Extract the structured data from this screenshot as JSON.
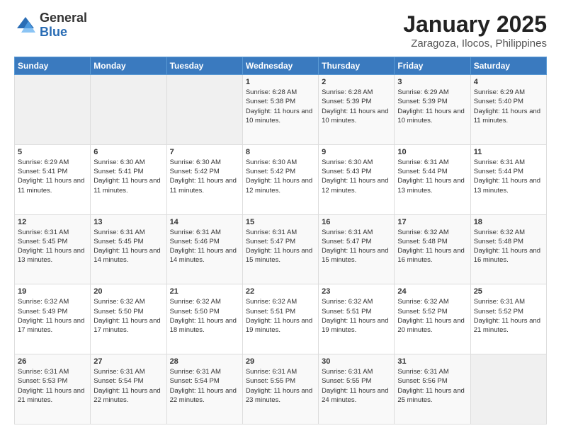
{
  "logo": {
    "general": "General",
    "blue": "Blue"
  },
  "title": "January 2025",
  "subtitle": "Zaragoza, Ilocos, Philippines",
  "days_of_week": [
    "Sunday",
    "Monday",
    "Tuesday",
    "Wednesday",
    "Thursday",
    "Friday",
    "Saturday"
  ],
  "weeks": [
    [
      {
        "day": "",
        "sunrise": "",
        "sunset": "",
        "daylight": "",
        "empty": true
      },
      {
        "day": "",
        "sunrise": "",
        "sunset": "",
        "daylight": "",
        "empty": true
      },
      {
        "day": "",
        "sunrise": "",
        "sunset": "",
        "daylight": "",
        "empty": true
      },
      {
        "day": "1",
        "sunrise": "Sunrise: 6:28 AM",
        "sunset": "Sunset: 5:38 PM",
        "daylight": "Daylight: 11 hours and 10 minutes.",
        "empty": false
      },
      {
        "day": "2",
        "sunrise": "Sunrise: 6:28 AM",
        "sunset": "Sunset: 5:39 PM",
        "daylight": "Daylight: 11 hours and 10 minutes.",
        "empty": false
      },
      {
        "day": "3",
        "sunrise": "Sunrise: 6:29 AM",
        "sunset": "Sunset: 5:39 PM",
        "daylight": "Daylight: 11 hours and 10 minutes.",
        "empty": false
      },
      {
        "day": "4",
        "sunrise": "Sunrise: 6:29 AM",
        "sunset": "Sunset: 5:40 PM",
        "daylight": "Daylight: 11 hours and 11 minutes.",
        "empty": false
      }
    ],
    [
      {
        "day": "5",
        "sunrise": "Sunrise: 6:29 AM",
        "sunset": "Sunset: 5:41 PM",
        "daylight": "Daylight: 11 hours and 11 minutes.",
        "empty": false
      },
      {
        "day": "6",
        "sunrise": "Sunrise: 6:30 AM",
        "sunset": "Sunset: 5:41 PM",
        "daylight": "Daylight: 11 hours and 11 minutes.",
        "empty": false
      },
      {
        "day": "7",
        "sunrise": "Sunrise: 6:30 AM",
        "sunset": "Sunset: 5:42 PM",
        "daylight": "Daylight: 11 hours and 11 minutes.",
        "empty": false
      },
      {
        "day": "8",
        "sunrise": "Sunrise: 6:30 AM",
        "sunset": "Sunset: 5:42 PM",
        "daylight": "Daylight: 11 hours and 12 minutes.",
        "empty": false
      },
      {
        "day": "9",
        "sunrise": "Sunrise: 6:30 AM",
        "sunset": "Sunset: 5:43 PM",
        "daylight": "Daylight: 11 hours and 12 minutes.",
        "empty": false
      },
      {
        "day": "10",
        "sunrise": "Sunrise: 6:31 AM",
        "sunset": "Sunset: 5:44 PM",
        "daylight": "Daylight: 11 hours and 13 minutes.",
        "empty": false
      },
      {
        "day": "11",
        "sunrise": "Sunrise: 6:31 AM",
        "sunset": "Sunset: 5:44 PM",
        "daylight": "Daylight: 11 hours and 13 minutes.",
        "empty": false
      }
    ],
    [
      {
        "day": "12",
        "sunrise": "Sunrise: 6:31 AM",
        "sunset": "Sunset: 5:45 PM",
        "daylight": "Daylight: 11 hours and 13 minutes.",
        "empty": false
      },
      {
        "day": "13",
        "sunrise": "Sunrise: 6:31 AM",
        "sunset": "Sunset: 5:45 PM",
        "daylight": "Daylight: 11 hours and 14 minutes.",
        "empty": false
      },
      {
        "day": "14",
        "sunrise": "Sunrise: 6:31 AM",
        "sunset": "Sunset: 5:46 PM",
        "daylight": "Daylight: 11 hours and 14 minutes.",
        "empty": false
      },
      {
        "day": "15",
        "sunrise": "Sunrise: 6:31 AM",
        "sunset": "Sunset: 5:47 PM",
        "daylight": "Daylight: 11 hours and 15 minutes.",
        "empty": false
      },
      {
        "day": "16",
        "sunrise": "Sunrise: 6:31 AM",
        "sunset": "Sunset: 5:47 PM",
        "daylight": "Daylight: 11 hours and 15 minutes.",
        "empty": false
      },
      {
        "day": "17",
        "sunrise": "Sunrise: 6:32 AM",
        "sunset": "Sunset: 5:48 PM",
        "daylight": "Daylight: 11 hours and 16 minutes.",
        "empty": false
      },
      {
        "day": "18",
        "sunrise": "Sunrise: 6:32 AM",
        "sunset": "Sunset: 5:48 PM",
        "daylight": "Daylight: 11 hours and 16 minutes.",
        "empty": false
      }
    ],
    [
      {
        "day": "19",
        "sunrise": "Sunrise: 6:32 AM",
        "sunset": "Sunset: 5:49 PM",
        "daylight": "Daylight: 11 hours and 17 minutes.",
        "empty": false
      },
      {
        "day": "20",
        "sunrise": "Sunrise: 6:32 AM",
        "sunset": "Sunset: 5:50 PM",
        "daylight": "Daylight: 11 hours and 17 minutes.",
        "empty": false
      },
      {
        "day": "21",
        "sunrise": "Sunrise: 6:32 AM",
        "sunset": "Sunset: 5:50 PM",
        "daylight": "Daylight: 11 hours and 18 minutes.",
        "empty": false
      },
      {
        "day": "22",
        "sunrise": "Sunrise: 6:32 AM",
        "sunset": "Sunset: 5:51 PM",
        "daylight": "Daylight: 11 hours and 19 minutes.",
        "empty": false
      },
      {
        "day": "23",
        "sunrise": "Sunrise: 6:32 AM",
        "sunset": "Sunset: 5:51 PM",
        "daylight": "Daylight: 11 hours and 19 minutes.",
        "empty": false
      },
      {
        "day": "24",
        "sunrise": "Sunrise: 6:32 AM",
        "sunset": "Sunset: 5:52 PM",
        "daylight": "Daylight: 11 hours and 20 minutes.",
        "empty": false
      },
      {
        "day": "25",
        "sunrise": "Sunrise: 6:31 AM",
        "sunset": "Sunset: 5:52 PM",
        "daylight": "Daylight: 11 hours and 21 minutes.",
        "empty": false
      }
    ],
    [
      {
        "day": "26",
        "sunrise": "Sunrise: 6:31 AM",
        "sunset": "Sunset: 5:53 PM",
        "daylight": "Daylight: 11 hours and 21 minutes.",
        "empty": false
      },
      {
        "day": "27",
        "sunrise": "Sunrise: 6:31 AM",
        "sunset": "Sunset: 5:54 PM",
        "daylight": "Daylight: 11 hours and 22 minutes.",
        "empty": false
      },
      {
        "day": "28",
        "sunrise": "Sunrise: 6:31 AM",
        "sunset": "Sunset: 5:54 PM",
        "daylight": "Daylight: 11 hours and 22 minutes.",
        "empty": false
      },
      {
        "day": "29",
        "sunrise": "Sunrise: 6:31 AM",
        "sunset": "Sunset: 5:55 PM",
        "daylight": "Daylight: 11 hours and 23 minutes.",
        "empty": false
      },
      {
        "day": "30",
        "sunrise": "Sunrise: 6:31 AM",
        "sunset": "Sunset: 5:55 PM",
        "daylight": "Daylight: 11 hours and 24 minutes.",
        "empty": false
      },
      {
        "day": "31",
        "sunrise": "Sunrise: 6:31 AM",
        "sunset": "Sunset: 5:56 PM",
        "daylight": "Daylight: 11 hours and 25 minutes.",
        "empty": false
      },
      {
        "day": "",
        "sunrise": "",
        "sunset": "",
        "daylight": "",
        "empty": true
      }
    ]
  ]
}
